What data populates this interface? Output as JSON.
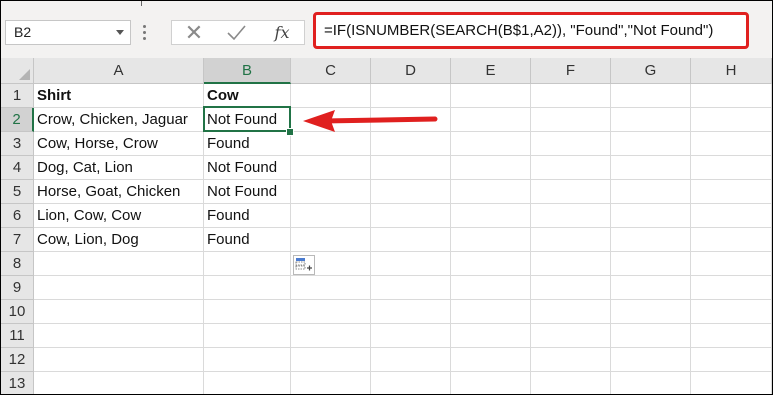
{
  "name_box": {
    "value": "B2"
  },
  "formula_bar": {
    "cancel_glyph": "✕",
    "func_glyph": "fx",
    "formula": "=IF(ISNUMBER(SEARCH(B$1,A2)), \"Found\",\"Not Found\")"
  },
  "columns": [
    "A",
    "B",
    "C",
    "D",
    "E",
    "F",
    "G",
    "H"
  ],
  "rows": [
    "1",
    "2",
    "3",
    "4",
    "5",
    "6",
    "7",
    "8",
    "9",
    "10",
    "11",
    "12",
    "13"
  ],
  "cells": [
    {
      "A": "Shirt",
      "B": "Cow"
    },
    {
      "A": "Crow, Chicken, Jaguar",
      "B": "Not Found"
    },
    {
      "A": "Cow, Horse, Crow",
      "B": "Found"
    },
    {
      "A": "Dog, Cat, Lion",
      "B": "Not Found"
    },
    {
      "A": "Horse, Goat, Chicken",
      "B": "Not Found"
    },
    {
      "A": "Lion, Cow, Cow",
      "B": "Found"
    },
    {
      "A": "Cow, Lion, Dog",
      "B": "Found"
    }
  ],
  "colors": {
    "annotation_red": "#e0201f",
    "excel_green": "#217346"
  },
  "icons": {
    "quick_analysis": "quick-analysis-icon",
    "annotation_arrow": "red-arrow-icon"
  }
}
